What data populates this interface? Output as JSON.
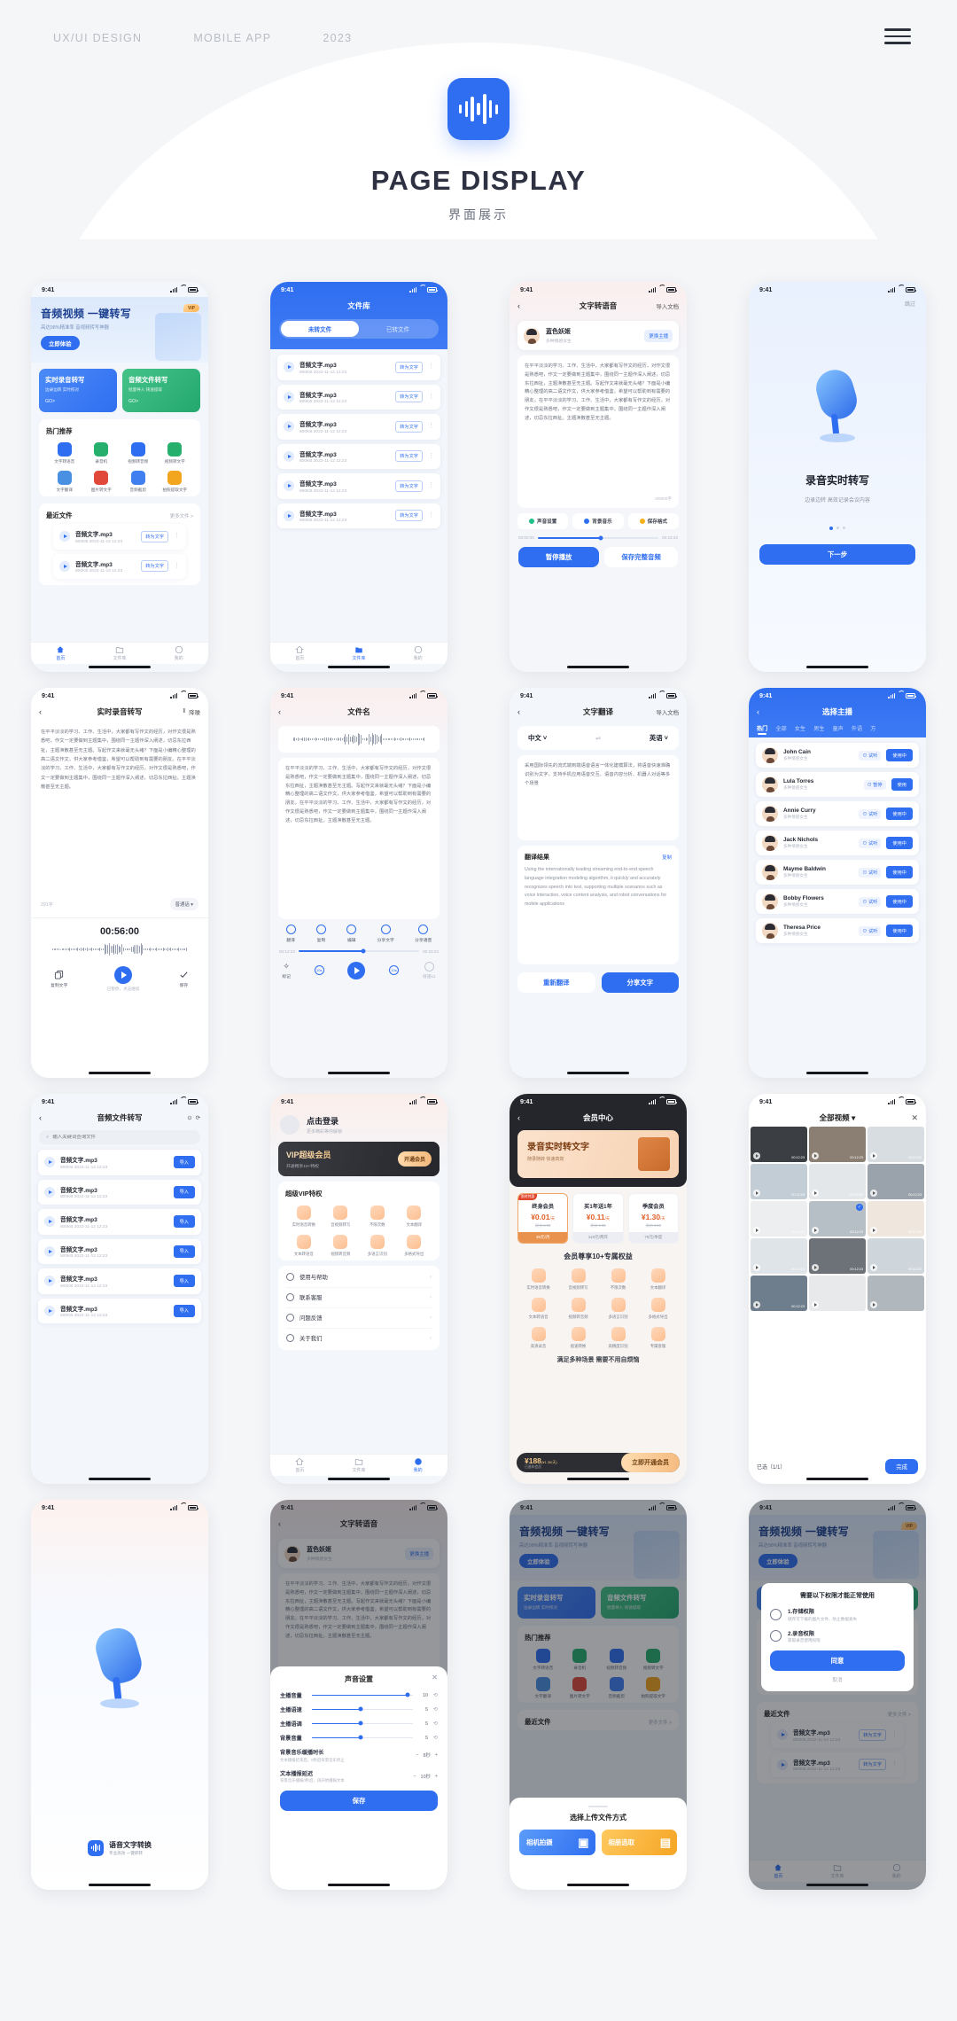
{
  "header": {
    "kicker": [
      "UX/UI DESIGN",
      "MOBILE APP",
      "2023"
    ],
    "title": "PAGE DISPLAY",
    "subtitle": "界面展示",
    "menu_icon": "hamburger-menu-icon",
    "logo_icon": "audio-waveform-logo-icon",
    "accent": "#2f6ef0"
  },
  "common": {
    "time": "9:41",
    "file_name": "音频文字.mp3",
    "file_meta": "800KB  2022-11-12 12:23",
    "to_text_btn": "转为文字",
    "import_btn": "导入",
    "tab_home": "首页",
    "tab_files": "文件库",
    "tab_mine": "我的",
    "back_icon": "chevron-left-icon",
    "body_text": "在平平淡淡的学习、工作、生活中，大家都有写作文的经历，对作文很是熟悉吧，作文一定要做到主题集中，围绕同一主题作深入阐述，切忌东拉西扯，主题涣散甚至无主题。写起作文来就毫无头绪？下面是小编精心整理的高二语文作文，供大家参考借鉴，希望可以帮助到有需要的朋友。在平平淡淡的学习、工作、生活中，大家都有写作文的经历，对作文很是熟悉吧，作文一定要做到主题集中，围绕同一主题作深入阐述，切忌东拉西扯。主题涣散甚至无主题。"
  },
  "p1": {
    "title": "音频视频  一键转写",
    "subtitle": "高达98%精准率  音视频转写神器",
    "cta": "立即体验",
    "vip": "VIP",
    "card_a_title": "实时录音转写",
    "card_a_sub": "边录边转  实时校对",
    "card_b_title": "音频文件转写",
    "card_b_sub": "批量导入  快速提取",
    "go": "GO>",
    "hot_title": "热门推荐",
    "hot": [
      {
        "label": "文字转语音",
        "color": "#2f6ef0"
      },
      {
        "label": "录音机",
        "color": "#27b06d"
      },
      {
        "label": "视频转音频",
        "color": "#2f6ef0"
      },
      {
        "label": "视频转文字",
        "color": "#27b06d"
      },
      {
        "label": "文字翻译",
        "color": "#4a90e2"
      },
      {
        "label": "图片转文字",
        "color": "#e0483a"
      },
      {
        "label": "音频截剪",
        "color": "#3f7ff0"
      },
      {
        "label": "拍照提取文字",
        "color": "#f2a51e"
      }
    ],
    "recent_title": "最近文件",
    "recent_more": "更多文件 >"
  },
  "p2": {
    "title": "文件库",
    "seg": [
      "未转文件",
      "已转文件"
    ],
    "rows": 6
  },
  "p3": {
    "title": "文字转语音",
    "import": "导入文档",
    "speaker_name": "蓝色妖姬",
    "speaker_sub": "多种情感女生",
    "change_btn": "更换主播",
    "counter": "0/5000字",
    "opts": [
      "声音设置",
      "背景音乐",
      "保存格式"
    ],
    "time_start": "00:00:00",
    "time_end": "00:23:23",
    "btn_pause": "暂停播放",
    "btn_save": "保存完整音频"
  },
  "p4": {
    "skip": "跳过",
    "title": "录音实时转写",
    "subtitle": "边录边转 高效记录会议内容",
    "next": "下一步"
  },
  "p5": {
    "title": "实时录音转写",
    "denoise": "降噪",
    "count": "291字",
    "lang": "普通话 ▾",
    "timer": "00:56:00",
    "btn_copy": "复制文字",
    "btn_save": "保存",
    "hint": "已暂停，点击继续"
  },
  "p6": {
    "title": "文件名",
    "acts": [
      "翻译",
      "复制",
      "编辑",
      "分享文字",
      "分享语音"
    ],
    "time_start": "00:12:23",
    "time_end": "00:23:23",
    "controls": [
      "标记",
      "10s",
      "10s",
      "倍速x1"
    ]
  },
  "p7": {
    "title": "文字翻译",
    "import": "导入文档",
    "lang_from": "中文 ˅",
    "swap_icon": "swap-arrows-icon",
    "lang_to": "英语 ˅",
    "source": "采用国际领先的流式端到端语音语言一体化建模算法，将语音快速准确识别为文字，支持手机应用语音交互、语音内容分析、机器人对话等多个场景",
    "result_title": "翻译结果",
    "copy": "复制",
    "result": "Using the internationally leading streaming end-to-end speech language integration modeling algorithm, it quickly and accurately recognizes speech into text, supporting multiple scenarios such as voice interaction, voice content analysis, and robot conversations for mobile applications",
    "btn_retry": "重新翻译",
    "btn_share": "分享文字"
  },
  "p8": {
    "title": "选择主播",
    "tabs": [
      "热门",
      "全部",
      "女生",
      "男生",
      "童声",
      "外语",
      "方"
    ],
    "voices": [
      {
        "name": "John Cain",
        "sub": "多种情感女生",
        "trial": "试听",
        "use": "使用中"
      },
      {
        "name": "Lula Torres",
        "sub": "多种情感女生",
        "trial": "暂停",
        "use": "使用"
      },
      {
        "name": "Annie Curry",
        "sub": "多种情感女生",
        "trial": "试听",
        "use": "使用中"
      },
      {
        "name": "Jack Nichols",
        "sub": "多种情感女生",
        "trial": "试听",
        "use": "使用中"
      },
      {
        "name": "Mayme Baldwin",
        "sub": "多种情感女生",
        "trial": "试听",
        "use": "使用中"
      },
      {
        "name": "Bobby Flowers",
        "sub": "多种情感女生",
        "trial": "试听",
        "use": "使用中"
      },
      {
        "name": "Theresa Price",
        "sub": "多种情感女生",
        "trial": "试听",
        "use": "使用中"
      }
    ]
  },
  "p9": {
    "title": "音频文件转写",
    "help_icon": "question-circle-icon",
    "refresh_icon": "refresh-icon",
    "search_placeholder": "输入关键词查询文件",
    "rows": 6
  },
  "p10": {
    "login": "点击登录",
    "login_sub": "更多精彩等你解锁",
    "vip_title": "VIP超级会员",
    "vip_sub": "开通畅享10+特权",
    "vip_btn": "开通会员",
    "priv_title": "超级VIP特权",
    "privs": [
      "实时语音转换",
      "音视频转写",
      "不限次数",
      "文本翻译",
      "文本转语音",
      "视频转音频",
      "多语言识别",
      "多格式导出"
    ],
    "menu": [
      "使用与帮助",
      "联系客服",
      "问题反馈",
      "关于我们"
    ]
  },
  "p11": {
    "title": "会员中心",
    "banner_title": "录音实时转文字",
    "banner_sub": "随录随转  快速高效",
    "plans": [
      {
        "tag": "限时特惠",
        "name": "终身会员",
        "price": "¥0.01",
        "unit": "/天",
        "orig": "原价￥99",
        "foot": "39元/月"
      },
      {
        "tag": "",
        "name": "买1年送1年",
        "price": "¥0.11",
        "unit": "/天",
        "orig": "原价￥99",
        "foot": "119元/两年"
      },
      {
        "tag": "",
        "name": "季度会员",
        "price": "¥1.30",
        "unit": "/天",
        "orig": "原价￥99",
        "foot": "79元/季度"
      }
    ],
    "priv_title": "会员尊享10+专属权益",
    "privs": [
      "实时语音转换",
      "音视频转写",
      "不限次数",
      "文本翻译",
      "文本转语音",
      "视频转音频",
      "多语言识别",
      "多格式导出",
      "高清录音",
      "极速转换",
      "高精度识别",
      "专属客服"
    ],
    "foot_note": "满足多种场景  需要不用自烦恼",
    "pay_amount": "¥188",
    "pay_unit": "(¥1.30/天)",
    "pay_sub": "已选年会员",
    "pay_btn": "立即开通会员"
  },
  "p12": {
    "title": "全部视频 ▾",
    "close_icon": "close-x-icon",
    "duration": "00:12:23",
    "selected": "已选（1/1）",
    "done": "完成"
  },
  "p13": {
    "brand": "语音文字转换",
    "brand_sub": "专业高效  一键即转"
  },
  "p14": {
    "title": "文字转语音",
    "speaker_name": "蓝色妖姬",
    "speaker_sub": "多种情感女生",
    "change_btn": "更换主播",
    "sheet_title": "声音设置",
    "sliders": [
      {
        "label": "主播音量",
        "value": "10",
        "pct": 95
      },
      {
        "label": "主播语速",
        "value": "5",
        "pct": 48
      },
      {
        "label": "主播语调",
        "value": "5",
        "pct": 48
      },
      {
        "label": "背景音量",
        "value": "5",
        "pct": 48
      }
    ],
    "steppers": [
      {
        "label": "背景音乐缓播时长",
        "sub": "文本播报结束后，0秒后背景音乐停止",
        "value": "8秒"
      },
      {
        "label": "文本播报延迟",
        "sub": "背景音乐播报0秒后，再开始播报文本",
        "value": "10秒"
      }
    ],
    "save": "保存"
  },
  "p15": {
    "sheet_title": "选择上传文件方式",
    "camera": "相机拍摄",
    "album": "相册选取",
    "camera_icon": "camera-icon",
    "album_icon": "photo-icon"
  },
  "p16": {
    "perm_title": "需要以下权限才能正常使用",
    "perms": [
      {
        "num": "1.存储权限",
        "sub": "储存可下载的图片文件、防止数据丢失",
        "icon": "folder-icon"
      },
      {
        "num": "2.录音权限",
        "sub": "获取录音使用权限",
        "icon": "microphone-icon"
      }
    ],
    "agree": "同意",
    "cancel": "取消"
  }
}
